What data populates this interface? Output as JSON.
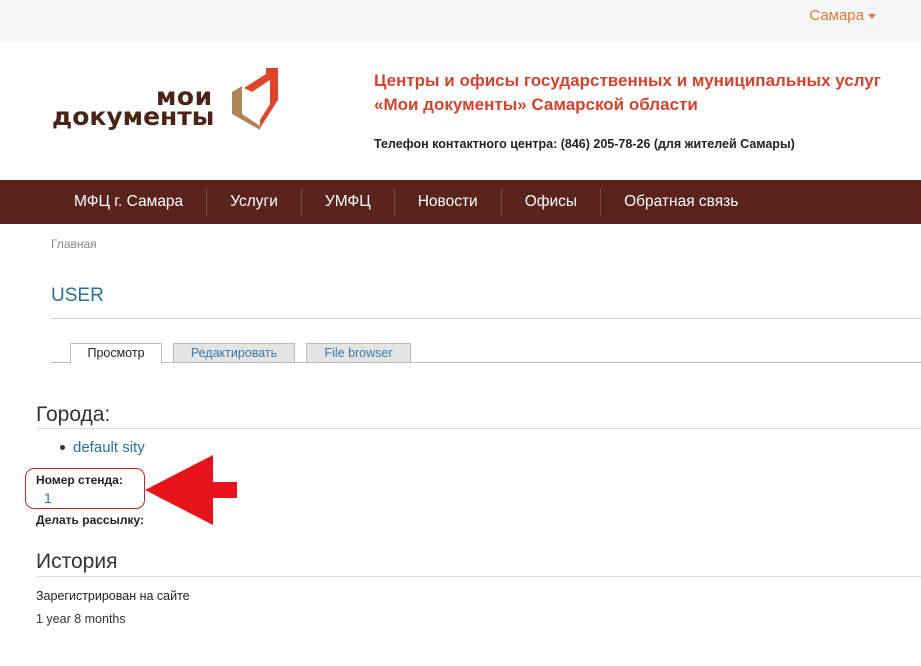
{
  "topbar": {
    "region_label": "Самара"
  },
  "logo": {
    "line1": "мои",
    "line2": "документы"
  },
  "header": {
    "title_line1": "Центры и офисы государственных и муниципальных услуг",
    "title_line2": "«Мои документы» Самарской области",
    "phone": "Телефон контактного центра: (846) 205-78-26 (для жителей Самары)"
  },
  "nav": {
    "items": [
      {
        "label": "МФЦ г. Самара"
      },
      {
        "label": "Услуги"
      },
      {
        "label": "УМФЦ"
      },
      {
        "label": "Новости"
      },
      {
        "label": "Офисы"
      },
      {
        "label": "Обратная связь"
      }
    ]
  },
  "breadcrumb": {
    "home": "Главная"
  },
  "page": {
    "title": "USER"
  },
  "tabs": [
    {
      "label": "Просмотр",
      "active": true
    },
    {
      "label": "Редактировать",
      "active": false
    },
    {
      "label": "File browser",
      "active": false
    }
  ],
  "profile": {
    "cities_heading": "Города:",
    "cities": [
      "default sity"
    ],
    "stand_label": "Номер стенда:",
    "stand_value": "1",
    "mailing_label": "Делать рассылку:",
    "history_heading": "История",
    "registered_label": "Зарегистрирован на сайте",
    "registered_value": "1 year 8 months"
  },
  "colors": {
    "brand_red": "#d1442d",
    "nav_bg": "#5a241c",
    "link": "#2b6fa1",
    "region": "#e07a37",
    "annotation": "#e8141b"
  }
}
